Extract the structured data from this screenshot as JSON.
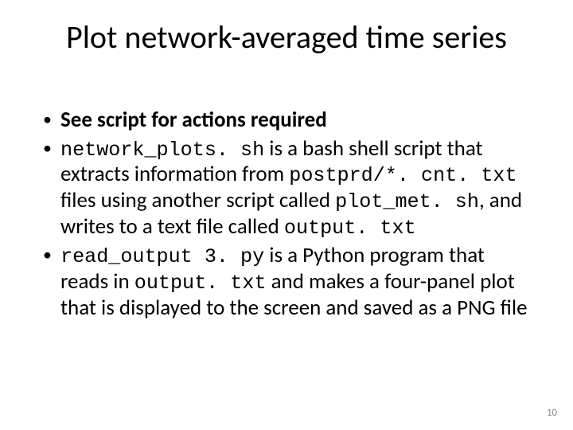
{
  "title": "Plot network-averaged time series",
  "bullets": {
    "b1": {
      "text": "See script for actions required"
    },
    "b2": {
      "code1": "network_plots. sh",
      "t1": " is a bash shell script that extracts information from ",
      "code2": "postprd/*. cnt. txt",
      "t2": " files using another script called ",
      "code3": "plot_met. sh",
      "t3": ", and writes to a text file called ",
      "code4": "output. txt"
    },
    "b3": {
      "code1": "read_output 3. py",
      "t1": " is a Python program that reads in ",
      "code2": "output. txt",
      "t2": " and makes a four-panel plot that is displayed to the screen and saved as a PNG file"
    }
  },
  "page_number": "10"
}
